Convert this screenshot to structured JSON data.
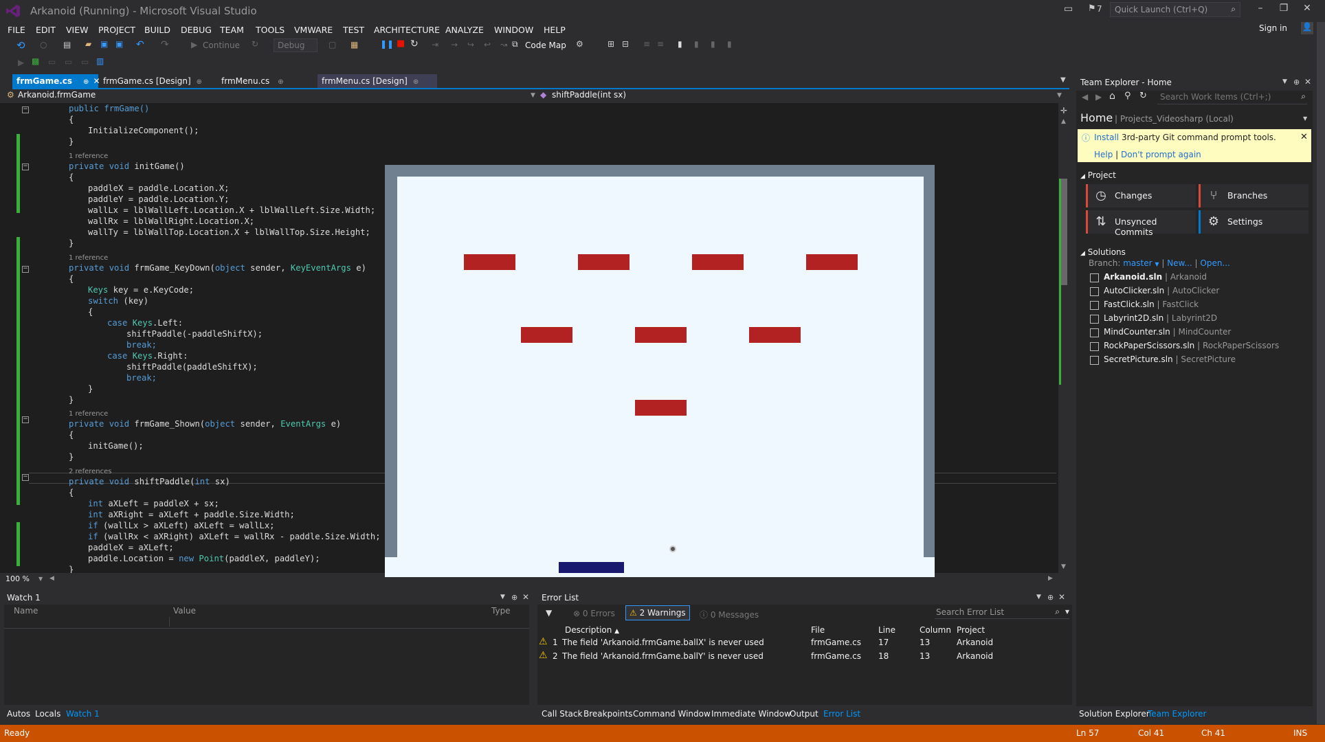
{
  "window": {
    "title": "Arkanoid (Running) - Microsoft Visual Studio",
    "quick_launch": "Quick Launch (Ctrl+Q)",
    "notif_count": "7",
    "sign_in": "Sign in"
  },
  "menu": [
    "FILE",
    "EDIT",
    "VIEW",
    "PROJECT",
    "BUILD",
    "DEBUG",
    "TEAM",
    "TOOLS",
    "VMWARE",
    "TEST",
    "ARCHITECTURE",
    "ANALYZE",
    "WINDOW",
    "HELP"
  ],
  "toolbar": {
    "continue": "Continue",
    "config": "Debug",
    "code_map": "Code Map"
  },
  "tabs": [
    "frmGame.cs",
    "frmGame.cs [Design]",
    "frmMenu.cs",
    "frmMenu.cs [Design]"
  ],
  "nav": {
    "class": "Arkanoid.frmGame",
    "member": "shiftPaddle(int sx)"
  },
  "code": {
    "l1": "public frmGame()",
    "l2": "{",
    "l3": "InitializeComponent();",
    "l4": "}",
    "ref1": "1 reference",
    "l5a": "private void",
    "l5b": " initGame()",
    "l6": "{",
    "l7": "paddleX = paddle.Location.X;",
    "l8": "paddleY = paddle.Location.Y;",
    "l9": "wallLx = lblWallLeft.Location.X + lblWallLeft.Size.Width;",
    "l10": "wallRx = lblWallRight.Location.X;",
    "l11": "wallTy = lblWallTop.Location.X + lblWallTop.Size.Height;",
    "l12": "}",
    "ref2": "1 reference",
    "l13a": "private void",
    "l13b": " frmGame_KeyDown(",
    "l13c": "object",
    "l13d": " sender, ",
    "l13e": "KeyEventArgs",
    "l13f": " e)",
    "l14": "{",
    "l15a": "Keys",
    "l15b": " key = e.KeyCode;",
    "l16a": "switch",
    "l16b": " (key)",
    "l17": "{",
    "l18a": "case",
    "l18b": " Keys",
    "l18c": ".Left:",
    "l19": "shiftPaddle(-paddleShiftX);",
    "l20": "break;",
    "l21a": "case",
    "l21b": " Keys",
    "l21c": ".Right:",
    "l22": "shiftPaddle(paddleShiftX);",
    "l23": "break;",
    "l24": "}",
    "l25": "}",
    "ref3": "1 reference",
    "l26a": "private void",
    "l26b": " frmGame_Shown(",
    "l26c": "object",
    "l26d": " sender, ",
    "l26e": "EventArgs",
    "l26f": " e)",
    "l27": "{",
    "l28": "initGame();",
    "l29": "}",
    "ref4": "2 references",
    "l30a": "private void",
    "l30b": " shiftPaddle(",
    "l30c": "int",
    "l30d": " sx)",
    "l31": "{",
    "l32a": "int",
    "l32b": " aXLeft = paddleX + sx;",
    "l33a": "int",
    "l33b": " aXRight = aXLeft + paddle.Size.Width;",
    "l34a": "if",
    "l34b": " (wallLx > aXLeft) aXLeft = wallLx;",
    "l35a": "if",
    "l35b": " (wallRx < aXRight) aXLeft = wallRx - paddle.Size.Width;",
    "l36": "paddleX = aXLeft;",
    "l37a": "paddle.Location = ",
    "l37b": "new",
    "l37c": " Point",
    "l37d": "(paddleX, paddleY);",
    "l38": "}",
    "l39": "}"
  },
  "zoom": "100 %",
  "watch": {
    "title": "Watch 1",
    "cols": [
      "Name",
      "Value",
      "Type"
    ]
  },
  "bottom_left_tabs": [
    "Autos",
    "Locals",
    "Watch 1"
  ],
  "error_list": {
    "title": "Error List",
    "errors": "0 Errors",
    "warnings": "2 Warnings",
    "messages": "0 Messages",
    "search": "Search Error List",
    "cols": [
      "Description",
      "File",
      "Line",
      "Column",
      "Project"
    ],
    "rows": [
      {
        "n": "1",
        "desc": "The field 'Arkanoid.frmGame.ballX' is never used",
        "file": "frmGame.cs",
        "line": "17",
        "col": "13",
        "proj": "Arkanoid"
      },
      {
        "n": "2",
        "desc": "The field 'Arkanoid.frmGame.ballY' is never used",
        "file": "frmGame.cs",
        "line": "18",
        "col": "13",
        "proj": "Arkanoid"
      }
    ]
  },
  "bottom_right_tabs": [
    "Call Stack",
    "Breakpoints",
    "Command Window",
    "Immediate Window",
    "Output",
    "Error List"
  ],
  "team_explorer": {
    "title": "Team Explorer - Home",
    "search": "Search Work Items (Ctrl+;)",
    "home": "Home",
    "project": "| Projects_Videosharp (Local)",
    "info_install": "Install",
    "info_text": " 3rd-party Git command prompt tools.",
    "info_help": "Help",
    "info_sep": " | ",
    "info_dont": "Don't prompt again",
    "section_project": "Project",
    "changes": "Changes",
    "branches": "Branches",
    "unsynced": "Unsynced Commits",
    "settings": "Settings",
    "section_solutions": "Solutions",
    "branch_label": "Branch:",
    "branch": "master",
    "new": "New...",
    "open": "Open...",
    "solutions": [
      {
        "name": "Arkanoid.sln",
        "proj": "Arkanoid"
      },
      {
        "name": "AutoClicker.sln",
        "proj": "AutoClicker"
      },
      {
        "name": "FastClick.sln",
        "proj": "FastClick"
      },
      {
        "name": "Labyrint2D.sln",
        "proj": "Labyrint2D"
      },
      {
        "name": "MindCounter.sln",
        "proj": "MindCounter"
      },
      {
        "name": "RockPaperScissors.sln",
        "proj": "RockPaperScissors"
      },
      {
        "name": "SecretPicture.sln",
        "proj": "SecretPicture"
      }
    ]
  },
  "right_tabs": [
    "Solution Explorer",
    "Team Explorer"
  ],
  "status": {
    "ready": "Ready",
    "ln": "Ln 57",
    "col": "Col 41",
    "ch": "Ch 41",
    "ins": "INS"
  },
  "colors": {
    "accent": "#007acc",
    "status": "#ca5100",
    "brick": "#b22222",
    "paddle": "#191970",
    "game_bg": "#f0f8ff",
    "game_wall": "#708090"
  }
}
